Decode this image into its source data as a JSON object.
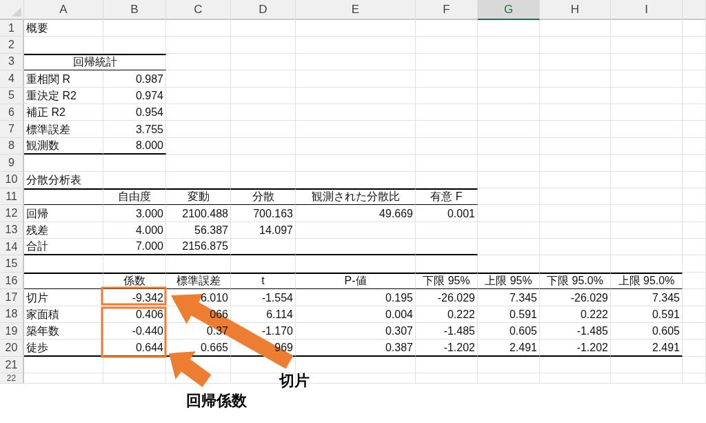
{
  "columns": [
    {
      "label": "A",
      "selected": false
    },
    {
      "label": "B",
      "selected": false
    },
    {
      "label": "C",
      "selected": false
    },
    {
      "label": "D",
      "selected": false
    },
    {
      "label": "E",
      "selected": false
    },
    {
      "label": "F",
      "selected": false
    },
    {
      "label": "G",
      "selected": true
    },
    {
      "label": "H",
      "selected": false
    },
    {
      "label": "I",
      "selected": false
    }
  ],
  "rows": [
    {
      "number": "1",
      "kind": "body",
      "a": "概要"
    },
    {
      "number": "2",
      "kind": "body"
    },
    {
      "number": "3",
      "kind": "title",
      "a": "回帰統計"
    },
    {
      "number": "4",
      "kind": "body",
      "a": "重相関 R",
      "b": "0.987"
    },
    {
      "number": "5",
      "kind": "body",
      "a": "重決定 R2",
      "b": "0.974"
    },
    {
      "number": "6",
      "kind": "body",
      "a": "補正 R2",
      "b": "0.954"
    },
    {
      "number": "7",
      "kind": "body",
      "a": "標準誤差",
      "b": "3.755"
    },
    {
      "number": "8",
      "kind": "body",
      "a": "観測数",
      "b": "8.000"
    },
    {
      "number": "9",
      "kind": "body"
    },
    {
      "number": "10",
      "kind": "body",
      "a": "分散分析表"
    },
    {
      "number": "11",
      "kind": "header",
      "b": "自由度",
      "c": "変動",
      "d": "分散",
      "e": "観測された分散比",
      "f": "有意 F"
    },
    {
      "number": "12",
      "kind": "body",
      "a": "回帰",
      "b": "3.000",
      "c": "2100.488",
      "d": "700.163",
      "e": "49.669",
      "f": "0.001"
    },
    {
      "number": "13",
      "kind": "body",
      "a": "残差",
      "b": "4.000",
      "c": "56.387",
      "d": "14.097"
    },
    {
      "number": "14",
      "kind": "body",
      "a": "合計",
      "b": "7.000",
      "c": "2156.875"
    },
    {
      "number": "15",
      "kind": "body"
    },
    {
      "number": "16",
      "kind": "header",
      "b": "係数",
      "c": "標準誤差",
      "d": "t",
      "e": "P-値",
      "f": "下限 95%",
      "g": "上限 95%",
      "h": "下限 95.0%",
      "i": "上限 95.0%"
    },
    {
      "number": "17",
      "kind": "body",
      "a": "切片",
      "b": "-9.342",
      "c": "6.010",
      "d": "-1.554",
      "e": "0.195",
      "f": "-26.029",
      "g": "7.345",
      "h": "-26.029",
      "i": "7.345"
    },
    {
      "number": "18",
      "kind": "body",
      "a": "家面積",
      "b": "0.406",
      "c": "066",
      "d": "6.114",
      "e": "0.004",
      "f": "0.222",
      "g": "0.591",
      "h": "0.222",
      "i": "0.591"
    },
    {
      "number": "19",
      "kind": "body",
      "a": "築年数",
      "b": "-0.440",
      "c": "0.37",
      "d": "-1.170",
      "e": "0.307",
      "f": "-1.485",
      "g": "0.605",
      "h": "-1.485",
      "i": "0.605"
    },
    {
      "number": "20",
      "kind": "body",
      "a": "徒歩",
      "b": "0.644",
      "c": "0.665",
      "d": "969",
      "e": "0.387",
      "f": "-1.202",
      "g": "2.491",
      "h": "-1.202",
      "i": "2.491"
    },
    {
      "number": "21",
      "kind": "body"
    },
    {
      "number": "22",
      "kind": "body"
    }
  ],
  "callouts": [
    {
      "label": "切片"
    },
    {
      "label": "回帰係数"
    }
  ]
}
